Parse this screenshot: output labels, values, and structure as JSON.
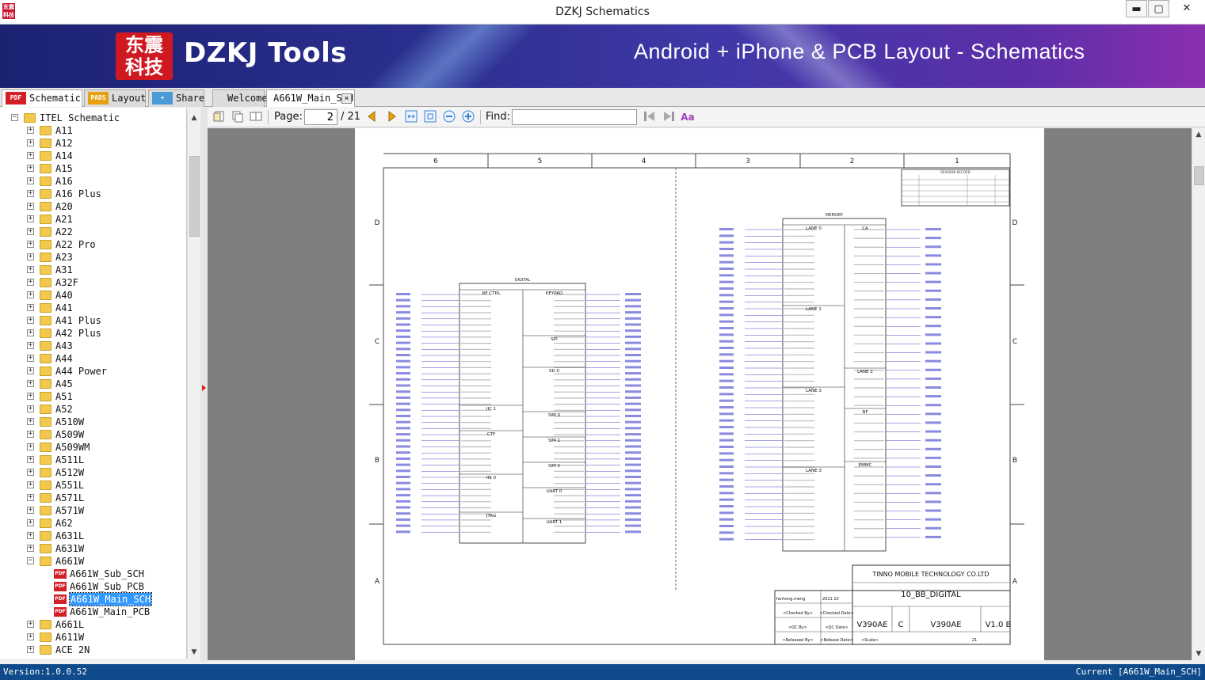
{
  "window": {
    "title": "DZKJ Schematics",
    "minimize": "▬",
    "maximize": "▢",
    "close": "✕"
  },
  "banner": {
    "logo_line1": "东震",
    "logo_line2": "科技",
    "brand": "DZKJ Tools",
    "tagline": "Android + iPhone & PCB Layout - Schematics"
  },
  "left_tabs": [
    {
      "label": "Schematic",
      "icon": "PDF",
      "color": "#d31f26"
    },
    {
      "label": "Layout",
      "icon": "PADS",
      "color": "#e8a010"
    },
    {
      "label": "Share",
      "icon": "+",
      "color": "#4a9ad8"
    }
  ],
  "doc_tabs": [
    {
      "label": "Welcome"
    },
    {
      "label": "A661W_Main_SCH"
    }
  ],
  "toolbar": {
    "page_label": "Page:",
    "page_value": "2",
    "page_total": "/ 21",
    "find_label": "Find:",
    "find_placeholder": ""
  },
  "tree": {
    "root": "ITEL Schematic",
    "folders": [
      "A11",
      "A12",
      "A14",
      "A15",
      "A16",
      "A16 Plus",
      "A20",
      "A21",
      "A22",
      "A22 Pro",
      "A23",
      "A31",
      "A32F",
      "A40",
      "A41",
      "A41 Plus",
      "A42 Plus",
      "A43",
      "A44",
      "A44 Power",
      "A45",
      "A51",
      "A52",
      "A510W",
      "A509W",
      "A509WM",
      "A511L",
      "A512W",
      "A551L",
      "A571L",
      "A571W",
      "A62",
      "A631L",
      "A631W",
      "A661W"
    ],
    "open_children": [
      "A661W_Sub_SCH",
      "A661W_Sub_PCB",
      "A661W_Main_SCH",
      "A661W_Main_PCB"
    ],
    "selected": "A661W_Main_SCH",
    "after": [
      "A661L",
      "A611W",
      "ACE 2N"
    ]
  },
  "schematic": {
    "col_labels": [
      "6",
      "5",
      "4",
      "3",
      "2",
      "1"
    ],
    "row_labels": [
      "D",
      "C",
      "B",
      "A"
    ],
    "company": "TINNO MOBILE TECHNOLOGY CO.LTD",
    "sheet_title": "10_BB_DIGITAL",
    "code": "V390AE",
    "size": "C",
    "drawing_no": "V390AE",
    "rev": "V1.0 B",
    "drawn": "fanhong.meng",
    "date": "2021.10",
    "checked": "<Checked By>",
    "checked_date": "<Checked Date>",
    "qc": "<QC By>",
    "qc_date": "<QC Date>",
    "released": "<Released By>",
    "release_date": "<Release Date>",
    "scale": "<Scale>",
    "sheet_no": "21",
    "revision_record": "REVISION RECORD",
    "left_blocks": [
      "DIGITAL",
      "RF CTRL",
      "KEYPAD",
      "SPI",
      "SD 0",
      "IIC 1",
      "SIM 0",
      "CTP",
      "SIM 1",
      "SIM 2",
      "IIS 0",
      "UART 0",
      "JTAG",
      "UART 1"
    ],
    "right_blocks": [
      "MEMORY",
      "LANE 0",
      "CA",
      "LANE 1",
      "LANE 2",
      "LANE 3",
      "NF",
      "EMMC"
    ]
  },
  "status": {
    "version": "Version:1.0.0.52",
    "current": "Current [A661W_Main_SCH]"
  }
}
